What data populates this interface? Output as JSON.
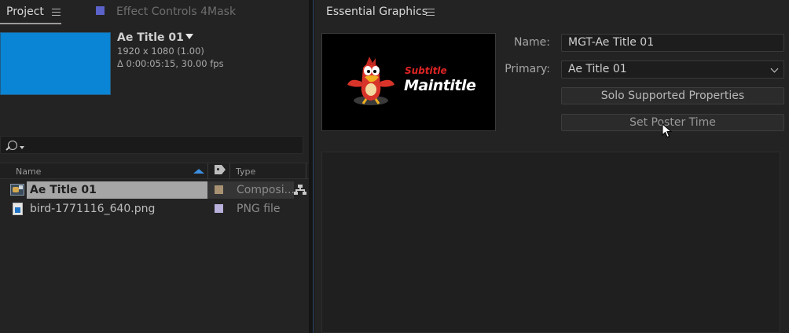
{
  "project_panel": {
    "tab_label": "Project",
    "effect_controls_tab": "Effect Controls 4Mask",
    "effect_controls_swatch": "#5b62c9",
    "comp": {
      "name": "Ae Title 01",
      "resolution": "1920 x 1080 (1.00)",
      "duration": "Δ 0:00:05:15, 30.00 fps",
      "thumb_color": "#0a84d4"
    },
    "columns": {
      "name": "Name",
      "type": "Type"
    },
    "items": [
      {
        "name": "Ae Title 01",
        "type": "Composi...",
        "icon": "composition-icon",
        "label_color": "#a89272",
        "selected": true
      },
      {
        "name": "bird-1771116_640.png",
        "type": "PNG file",
        "icon": "png-file-icon",
        "label_color": "#b9b0dc",
        "selected": false
      }
    ]
  },
  "essential_graphics": {
    "title": "Essential Graphics",
    "poster": {
      "top_text": "Subtitle",
      "main_text": "Maintitle"
    },
    "name_label": "Name:",
    "name_value": "MGT-Ae Title 01",
    "primary_label": "Primary:",
    "primary_value": "Ae Title 01",
    "solo_button": "Solo Supported Properties",
    "poster_button": "Set Poster Time"
  }
}
